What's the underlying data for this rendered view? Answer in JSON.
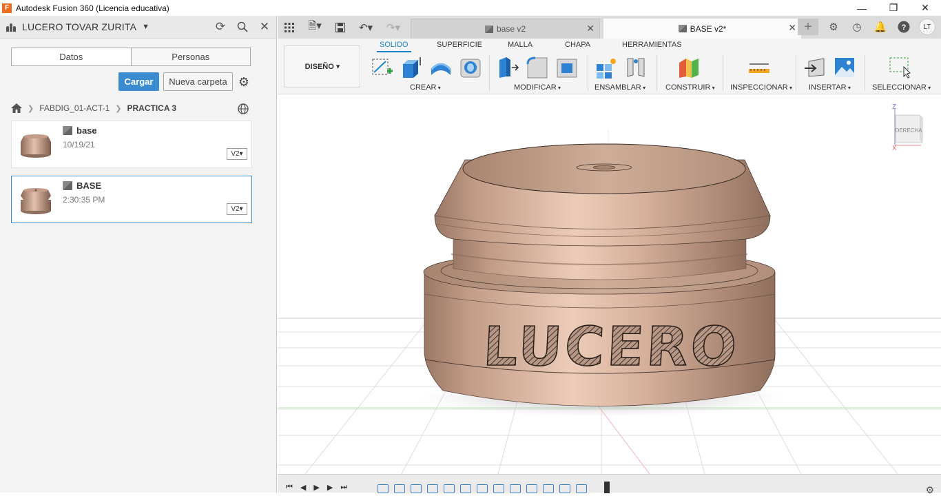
{
  "window": {
    "title": "Autodesk Fusion 360 (Licencia educativa)",
    "app_icon_letter": "F"
  },
  "left_panel": {
    "user_name": "LUCERO TOVAR ZURITA",
    "tabs": [
      "Datos",
      "Personas"
    ],
    "upload_label": "Cargar",
    "new_folder_label": "Nueva carpeta",
    "breadcrumb": [
      "FABDIG_01-ACT-1",
      "PRACTICA 3"
    ],
    "files": [
      {
        "name": "base",
        "date": "10/19/21",
        "version": "V2"
      },
      {
        "name": "BASE",
        "date": "2:30:35 PM",
        "version": "V2"
      }
    ]
  },
  "doc_tabs": [
    {
      "label": "base v2"
    },
    {
      "label": "BASE v2*"
    }
  ],
  "user_initials": "LT",
  "ribbon": {
    "workspace_label": "DISEÑO",
    "tabs": [
      "SOLIDO",
      "SUPERFICIE",
      "MALLA",
      "CHAPA",
      "HERRAMIENTAS"
    ],
    "groups": [
      "CREAR",
      "MODIFICAR",
      "ENSAMBLAR",
      "CONSTRUIR",
      "INSPECCIONAR",
      "INSERTAR",
      "SELECCIONAR"
    ]
  },
  "viewport": {
    "model_text": "LUCERO",
    "viewcube_face": "DERECHA",
    "axis_z": "Z",
    "axis_x": "X"
  },
  "colors": {
    "accent": "#3b8bd0",
    "model_bronze": "#c9a08a"
  }
}
